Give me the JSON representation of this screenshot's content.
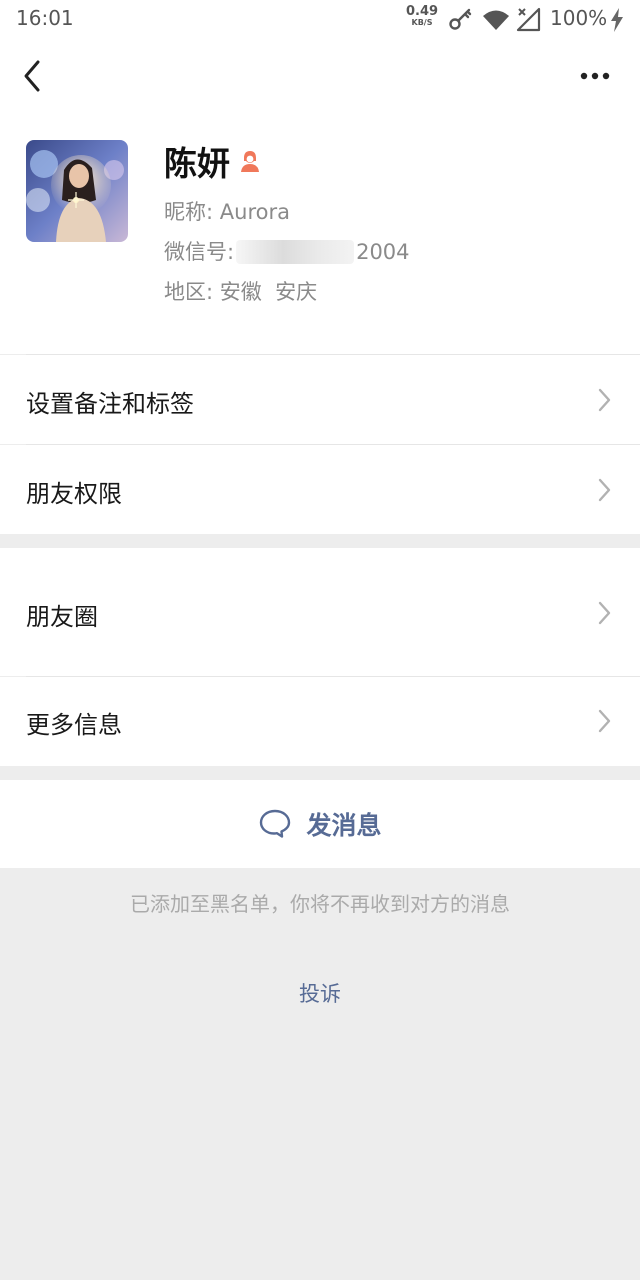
{
  "status_bar": {
    "time": "16:01",
    "net_speed_value": "0.49",
    "net_speed_unit": "KB/S",
    "battery_percent": "100%",
    "icons": [
      "key-icon",
      "wifi-icon",
      "no-signal-icon",
      "charging-icon"
    ]
  },
  "nav": {
    "back_icon": "chevron-left-icon",
    "more_icon": "more-dots-icon"
  },
  "profile": {
    "name": "陈妍",
    "gender_icon": "female-icon",
    "nickname_label": "昵称:",
    "nickname": "Aurora",
    "wechat_id_label": "微信号:",
    "wechat_id_visible_suffix": "2004",
    "region_label": "地区:",
    "region": "安徽  安庆"
  },
  "menu_group_1": [
    {
      "label": "设置备注和标签"
    },
    {
      "label": "朋友权限"
    }
  ],
  "menu_group_2": [
    {
      "label": "朋友圈"
    },
    {
      "label": "更多信息"
    }
  ],
  "actions": {
    "send_message_label": "发消息",
    "send_message_icon": "chat-bubble-icon"
  },
  "blacklist_notice": "已添加至黑名单，你将不再收到对方的消息",
  "complain_label": "投诉",
  "colors": {
    "link_blue": "#576b95",
    "background_gray": "#ededed",
    "gender_badge": "#f0785a"
  }
}
